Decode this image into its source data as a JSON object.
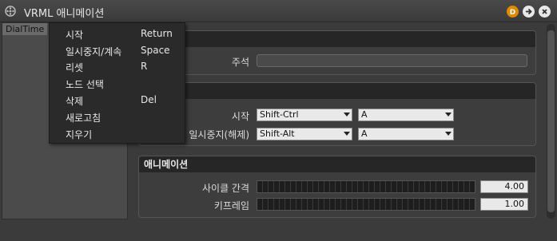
{
  "window": {
    "title": "VRML 애니메이션"
  },
  "left_panel": {
    "selected_item": "DialTime"
  },
  "menu": {
    "items": [
      {
        "label": "시작",
        "shortcut": "Return"
      },
      {
        "label": "일시중지/계속",
        "shortcut": "Space"
      },
      {
        "label": "리셋",
        "shortcut": "R"
      },
      {
        "label": "노드 선택",
        "shortcut": ""
      },
      {
        "label": "삭제",
        "shortcut": "Del"
      },
      {
        "label": "새로고침",
        "shortcut": ""
      },
      {
        "label": "지우기",
        "shortcut": ""
      }
    ]
  },
  "section1": {
    "comment_label": "주석",
    "comment_value": ""
  },
  "section2": {
    "start_label": "시작",
    "start_modifier": "Shift-Ctrl",
    "start_key": "A",
    "pause_label": "일시중지(해제)",
    "pause_modifier": "Shift-Alt",
    "pause_key": "A"
  },
  "animation": {
    "header": "애니메이션",
    "cycle_label": "사이클 간격",
    "cycle_value": "4.00",
    "keyframe_label": "키프레임",
    "keyframe_value": "1.00"
  },
  "colors": {
    "menu_bg": "#2a2a2a",
    "header_bg": "#262626",
    "d_button": "#e08a00"
  },
  "icons": {
    "app": "film-reel-icon",
    "d": "d-badge-icon",
    "forward": "arrow-right-icon",
    "close": "close-icon"
  }
}
